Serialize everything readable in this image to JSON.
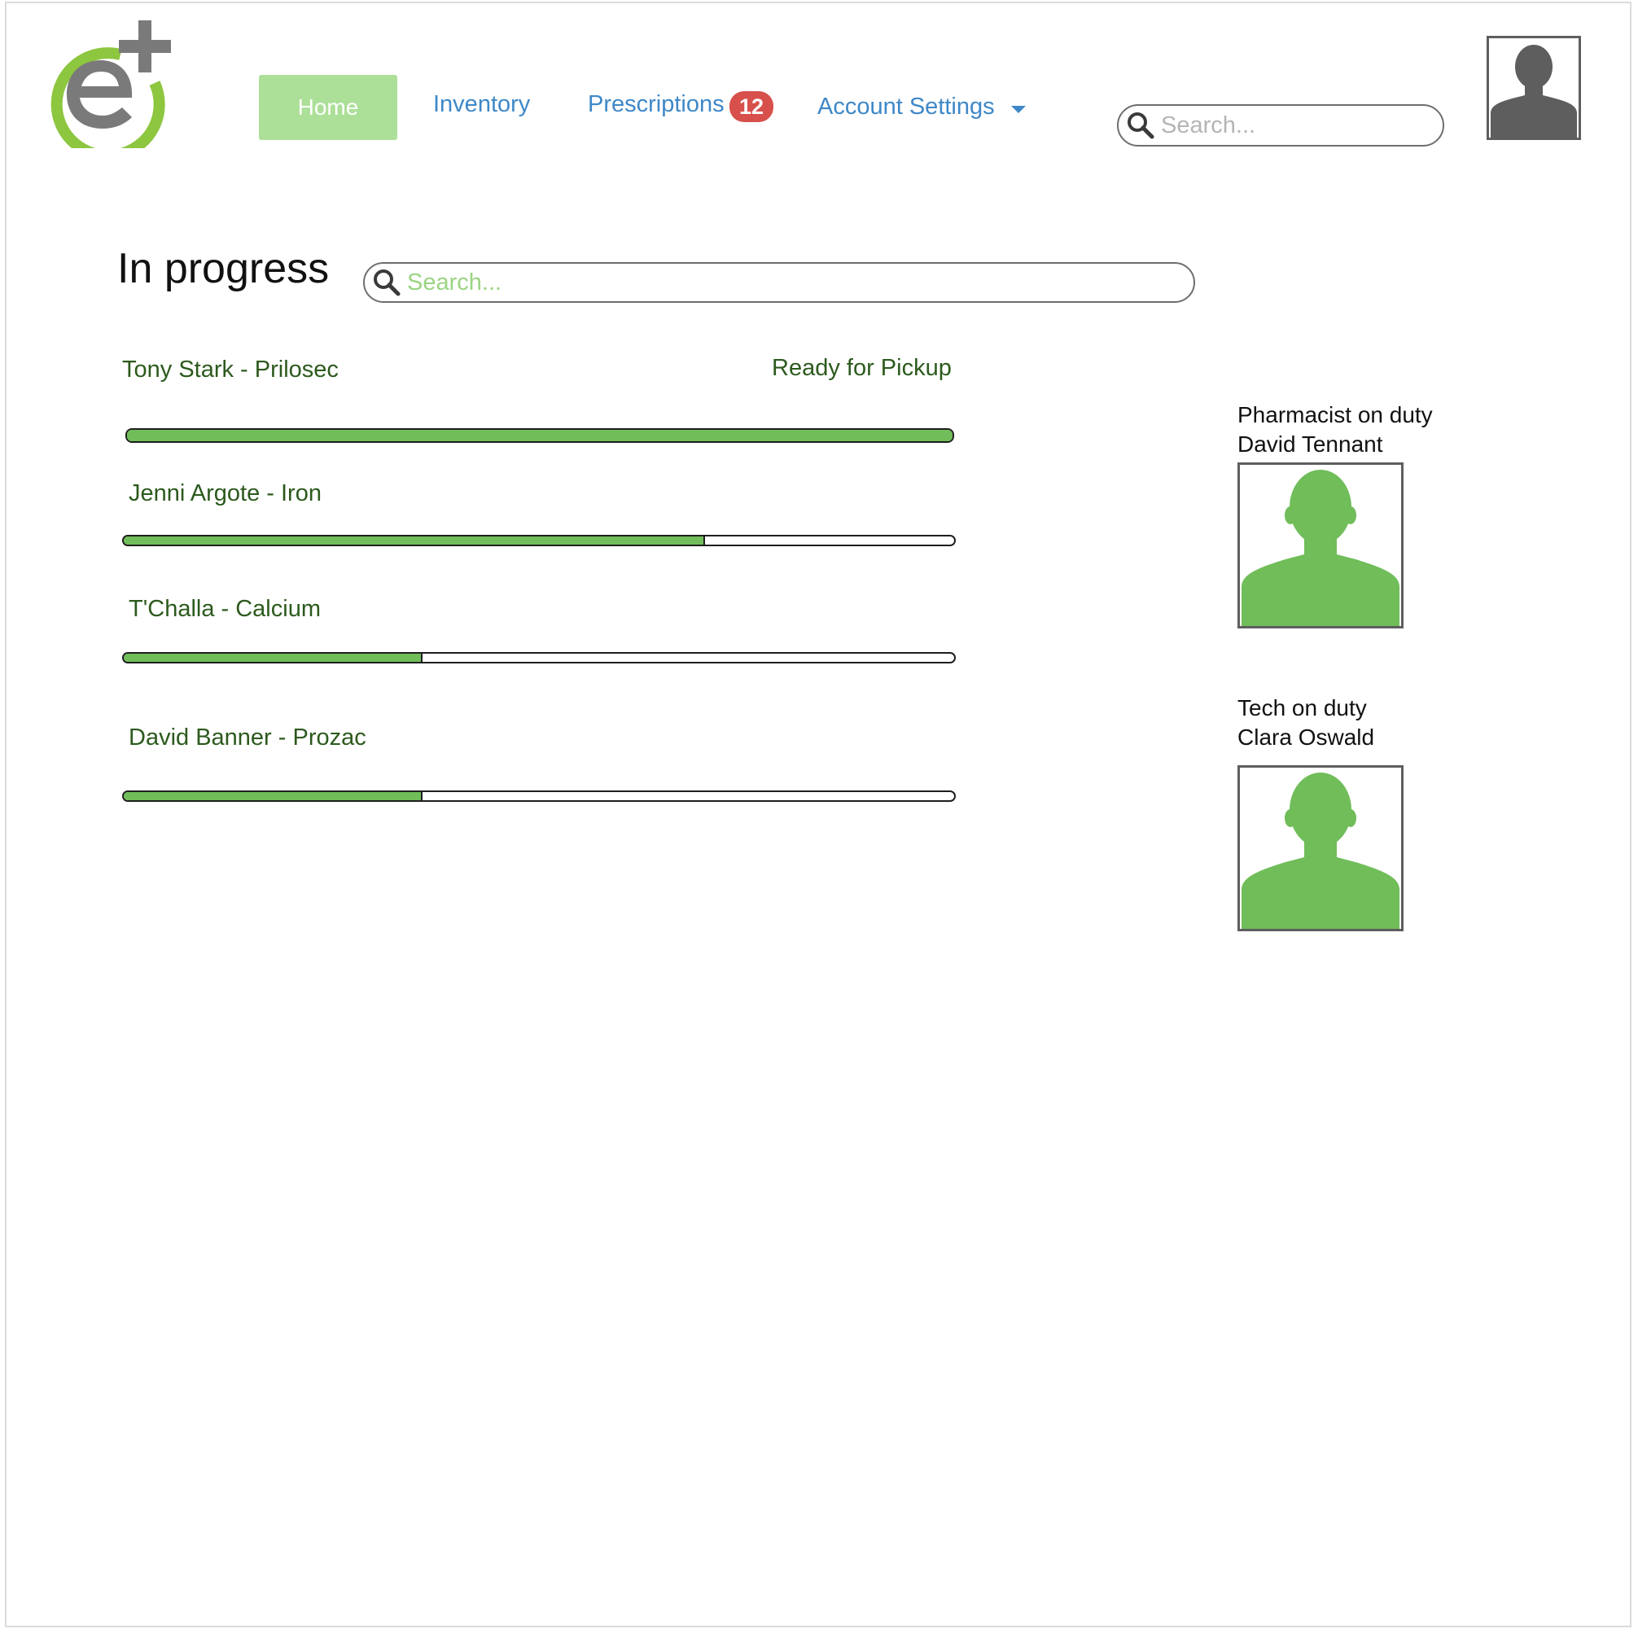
{
  "brand": {
    "logo_icon": "e-plus-logo",
    "accent": "#8dc63f",
    "logo_gray": "#7a7a7a"
  },
  "nav": {
    "home_label": "Home",
    "inventory_label": "Inventory",
    "prescriptions_label": "Prescriptions",
    "prescriptions_badge": "12",
    "account_label": "Account Settings"
  },
  "header_search": {
    "placeholder": "Search..."
  },
  "main": {
    "title": "In progress",
    "search_placeholder": "Search...",
    "prescriptions": [
      {
        "label": "Tony Stark - Prilosec",
        "status": "Ready for Pickup",
        "progress": 1.0
      },
      {
        "label": "Jenni Argote - Iron",
        "progress": 0.7
      },
      {
        "label": "T'Challa - Calcium",
        "progress": 0.36
      },
      {
        "label": "David Banner - Prozac",
        "progress": 0.36
      }
    ]
  },
  "staff": {
    "pharmacist_role": "Pharmacist on duty",
    "pharmacist_name": "David Tennant",
    "tech_role": "Tech on duty",
    "tech_name": "Clara Oswald"
  },
  "colors": {
    "progress_fill": "#70bd59",
    "home_button": "#acdf98",
    "link": "#3e88c8",
    "badge": "#d7504b",
    "label_text": "#2c5a1d"
  }
}
